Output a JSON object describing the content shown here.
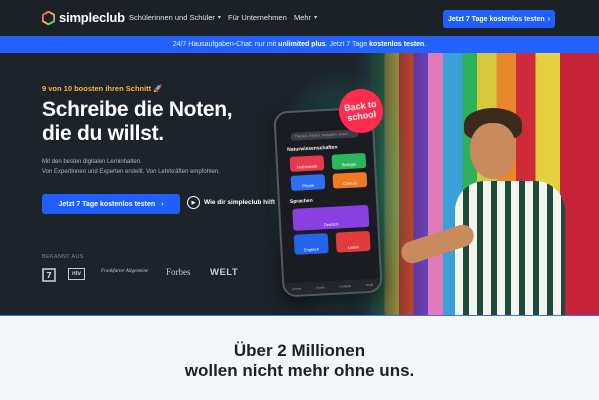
{
  "nav": {
    "brand": "simpleclub",
    "links": [
      {
        "label": "Schülerinnen und Schüler",
        "has_menu": true
      },
      {
        "label": "Für Unternehmen",
        "has_menu": false
      },
      {
        "label": "Mehr",
        "has_menu": true
      }
    ],
    "cta_label": "Jetzt 7 Tage kostenlos testen",
    "icons": [
      "hexagon-logo-icon",
      "chevron-down-icon",
      "chevron-right-icon"
    ]
  },
  "banner": {
    "prefix": "24/7 Hausaufgaben-Chat: nur mit",
    "bold1": "unlimited plus",
    "middle": ". Jetzt 7 Tage",
    "bold2": "kostenlos testen",
    "suffix": "."
  },
  "hero": {
    "kicker": "9 von 10 boosten ihren Schnitt 🚀",
    "headline_line1": "Schreibe die Noten,",
    "headline_line2": "die du willst.",
    "sub_line1": "Mit den besten digitalen Lerninhalten.",
    "sub_line2": "Von Expertinnen und Experten erstellt. Von Lehrkräften empfohlen.",
    "cta_label": "Jetzt 7 Tage kostenlos testen",
    "video_label": "Wie dir simpleclub hilft",
    "known_from": "BEKANNT AUS",
    "press_logos": [
      "ProSieben",
      "ntv",
      "Frankfurter Allgemeine",
      "Forbes",
      "WELT"
    ],
    "badge_line1": "Back to",
    "badge_line2": "school"
  },
  "phone": {
    "search_placeholder": "Themen, Fächer, Aufgaben, Kurse",
    "section1": "Naturwissenschaften",
    "section2": "Sprachen",
    "tiles": [
      {
        "label": "Mathematik",
        "color": "#e8394d"
      },
      {
        "label": "Biologie",
        "color": "#2db55d"
      },
      {
        "label": "Physik",
        "color": "#2f6ff2"
      },
      {
        "label": "Chemie",
        "color": "#f07a22"
      },
      {
        "label": "Deutsch",
        "color": "#8a3fe0"
      },
      {
        "label": "Englisch",
        "color": "#2563eb"
      },
      {
        "label": "Latein",
        "color": "#e23b3b"
      }
    ],
    "bottom_nav": [
      "Lernen",
      "Suche",
      "Lernplan",
      "Profil"
    ]
  },
  "stats": {
    "line1": "Über 2 Millionen",
    "line2": "wollen nicht mehr ohne uns."
  },
  "colors": {
    "accent": "#1f5fff",
    "hero_bg": "#1d232b",
    "kicker": "#ffb23d",
    "badge": "#ff2c4e"
  }
}
